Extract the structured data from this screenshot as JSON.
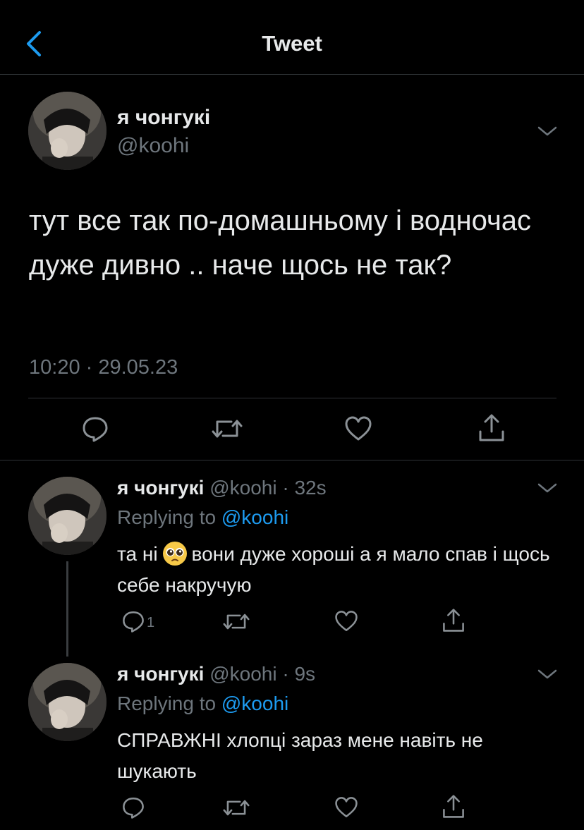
{
  "header": {
    "title": "Tweet",
    "back_icon": "chevron-left-icon"
  },
  "main_tweet": {
    "name": "я чонгукі",
    "handle": "@koohi",
    "text": "тут все так по-домашньому і водночас дуже дивно .. наче щось не так?",
    "timestamp": "10:20 · 29.05.23"
  },
  "replies": [
    {
      "name": "я чонгукі",
      "handle": "@koohi",
      "time": "· 32s",
      "replying_prefix": "Replying to",
      "replying_to": "@koohi",
      "text_before_emoji": "та ні",
      "emoji": "pleading-face-emoji",
      "text_after_emoji": "вони дуже хороші а я мало спав і щось себе накручую",
      "reply_count": "1"
    },
    {
      "name": "я чонгукі",
      "handle": "@koohi",
      "time": "· 9s",
      "replying_prefix": "Replying to",
      "replying_to": "@koohi",
      "text": "СПРАВЖНІ хлопці зараз мене навіть не шукають"
    }
  ],
  "colors": {
    "background": "#000000",
    "text": "#e7e9ea",
    "secondary": "#6e767d",
    "accent": "#1d9bf0",
    "divider": "#2f3336"
  }
}
